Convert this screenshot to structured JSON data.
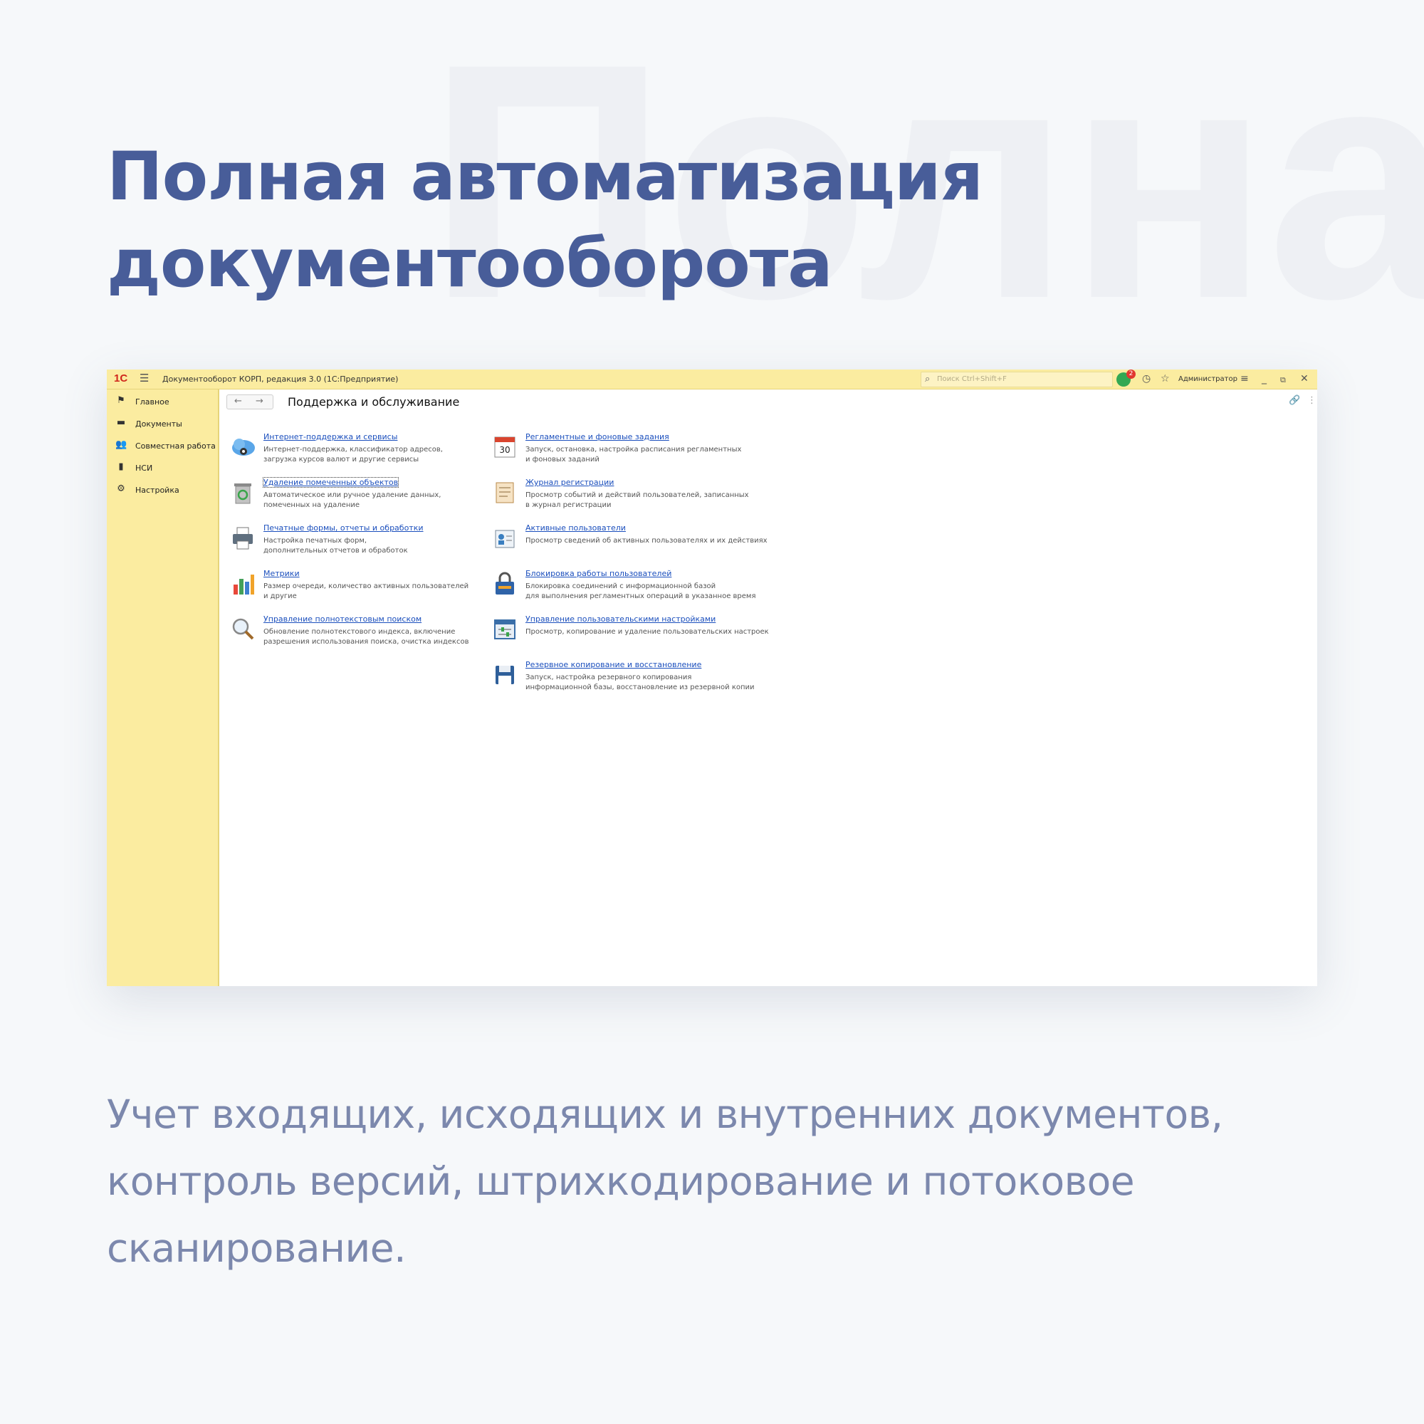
{
  "watermark": "Полна",
  "headline": "Полная автоматизация документооборота",
  "subtext": "Учет входящих, исходящих и внутренних документов, контроль версий, штрихкодирование и потоковое сканирование.",
  "app": {
    "logo": "1С",
    "menu_icon": "hamburger-icon",
    "window_title": "Документооборот КОРП, редакция 3.0  (1С:Предприятие)",
    "search_placeholder": "Поиск Ctrl+Shift+F",
    "notification_count": "2",
    "user": "Администратор",
    "page_title": "Поддержка и обслуживание"
  },
  "sidebar": {
    "items": [
      {
        "label": "Главное",
        "icon": "flag-icon"
      },
      {
        "label": "Документы",
        "icon": "folder-icon"
      },
      {
        "label": "Совместная работа",
        "icon": "users-icon"
      },
      {
        "label": "НСИ",
        "icon": "book-icon"
      },
      {
        "label": "Настройка",
        "icon": "gear-icon"
      }
    ]
  },
  "left_column": [
    {
      "title": "Интернет-поддержка и сервисы",
      "desc": "Интернет-поддержка, классификатор адресов,\nзагрузка курсов валют и другие сервисы",
      "icon": "cloud-gear-icon"
    },
    {
      "title": "Удаление помеченных объектов",
      "desc": "Автоматическое или ручное удаление данных,\nпомеченных на удаление",
      "icon": "recycle-bin-icon"
    },
    {
      "title": "Печатные формы, отчеты и обработки",
      "desc": "Настройка печатных форм,\nдополнительных отчетов и обработок",
      "icon": "printer-icon"
    },
    {
      "title": "Метрики",
      "desc": "Размер очереди, количество активных пользователей\nи другие",
      "icon": "bar-chart-icon"
    },
    {
      "title": "Управление полнотекстовым поиском",
      "desc": "Обновление полнотекстового индекса, включение\nразрешения использования поиска, очистка индексов",
      "icon": "magnifier-icon"
    }
  ],
  "right_column": [
    {
      "title": "Регламентные и фоновые задания",
      "desc": "Запуск, остановка, настройка расписания регламентных\nи фоновых заданий",
      "icon": "calendar-icon",
      "day": "30"
    },
    {
      "title": "Журнал регистрации",
      "desc": "Просмотр событий и действий пользователей, записанных\nв журнал регистрации",
      "icon": "journal-icon"
    },
    {
      "title": "Активные пользователи",
      "desc": "Просмотр сведений об активных пользователях и их действиях",
      "icon": "user-card-icon"
    },
    {
      "title": "Блокировка работы пользователей",
      "desc": "Блокировка соединений с информационной базой\nдля выполнения регламентных операций в указанное время",
      "icon": "lock-icon"
    },
    {
      "title": "Управление пользовательскими настройками",
      "desc": "Просмотр, копирование и удаление пользовательских настроек",
      "icon": "settings-panel-icon"
    },
    {
      "title": "Резервное копирование и восстановление",
      "desc": "Запуск, настройка резервного копирования\nинформационной базы, восстановление из резервной копии",
      "icon": "floppy-disk-icon"
    }
  ]
}
